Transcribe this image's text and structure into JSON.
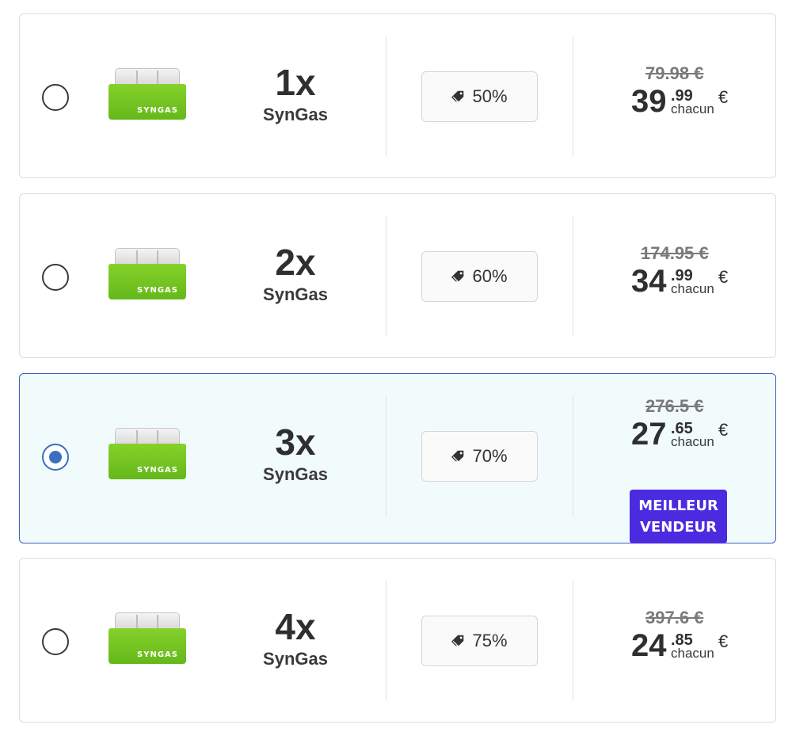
{
  "offers": [
    {
      "quantity": "1x",
      "product": "SynGas",
      "brand": "SYNGAS",
      "discount": "50%",
      "old_price": "79.98 €",
      "price_int": "39",
      "price_cents": ".99",
      "per_unit": "chacun",
      "currency": "€",
      "selected": false
    },
    {
      "quantity": "2x",
      "product": "SynGas",
      "brand": "SYNGAS",
      "discount": "60%",
      "old_price": "174.95 €",
      "price_int": "34",
      "price_cents": ".99",
      "per_unit": "chacun",
      "currency": "€",
      "selected": false
    },
    {
      "quantity": "3x",
      "product": "SynGas",
      "brand": "SYNGAS",
      "discount": "70%",
      "old_price": "276.5 €",
      "price_int": "27",
      "price_cents": ".65",
      "per_unit": "chacun",
      "currency": "€",
      "selected": true,
      "badge_line1": "MEILLEUR",
      "badge_line2": "VENDEUR"
    },
    {
      "quantity": "4x",
      "product": "SynGas",
      "brand": "SYNGAS",
      "discount": "75%",
      "old_price": "397.6 €",
      "price_int": "24",
      "price_cents": ".85",
      "per_unit": "chacun",
      "currency": "€",
      "selected": false
    }
  ],
  "colors": {
    "accent": "#3a6fc0",
    "badge": "#4b2be0",
    "product_green": "#6cc01e",
    "selected_bg": "#f2fbfb"
  }
}
